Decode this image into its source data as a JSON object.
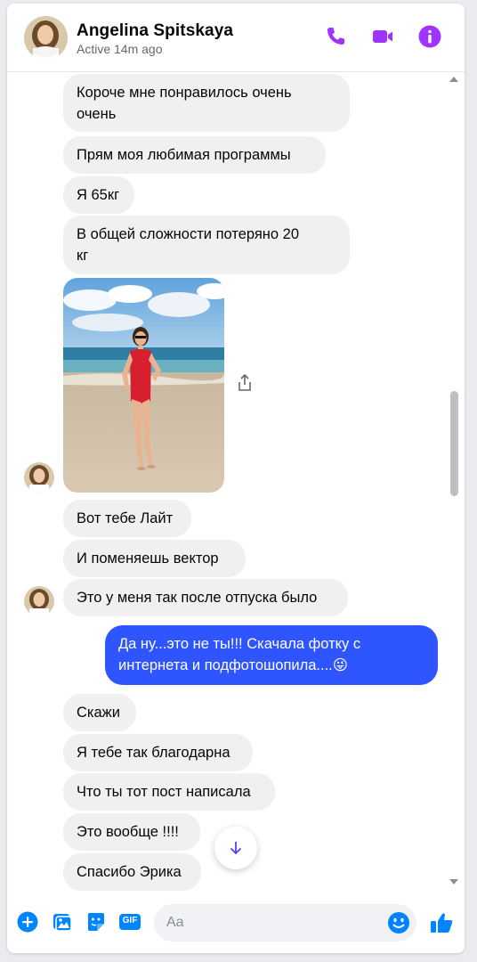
{
  "header": {
    "name": "Angelina Spitskaya",
    "status": "Active 14m ago",
    "accent_color": "#a033ff"
  },
  "messages": [
    {
      "dir": "in",
      "text": "Короче мне понравилось очень\nочень"
    },
    {
      "dir": "in",
      "text": "Прям моя любимая программы"
    },
    {
      "dir": "in",
      "text": "Я 65кг"
    },
    {
      "dir": "in",
      "text": "В общей сложности потеряно 20\nкг"
    },
    {
      "dir": "in",
      "type": "photo",
      "description": "woman-red-swimsuit-beach"
    },
    {
      "dir": "in",
      "text": "Вот тебе Лайт"
    },
    {
      "dir": "in",
      "text": "И поменяешь вектор"
    },
    {
      "dir": "in",
      "text": "Это у меня так после отпуска было"
    },
    {
      "dir": "out",
      "text": "Да ну...это не ты!!! Скачала фотку с\nинтернета и подфотошопила....😜"
    },
    {
      "dir": "in",
      "text": "Скажи"
    },
    {
      "dir": "in",
      "text": "Я тебе так благодарна"
    },
    {
      "dir": "in",
      "text": "Что ты тот пост написала"
    },
    {
      "dir": "in",
      "text": "Это вообще !!!!"
    },
    {
      "dir": "in",
      "text": "Спасибо Эрика"
    }
  ],
  "composer": {
    "placeholder": "Aa",
    "value": "",
    "accent_color": "#0084ff",
    "icons": [
      "plus-icon",
      "image-icon",
      "sticker-icon",
      "gif-icon",
      "emoji-icon",
      "thumbs-up-icon"
    ],
    "gif_label": "GIF"
  },
  "colors": {
    "outgoing_bubble": "#2e55ff",
    "incoming_bubble": "#f0f0f0"
  }
}
